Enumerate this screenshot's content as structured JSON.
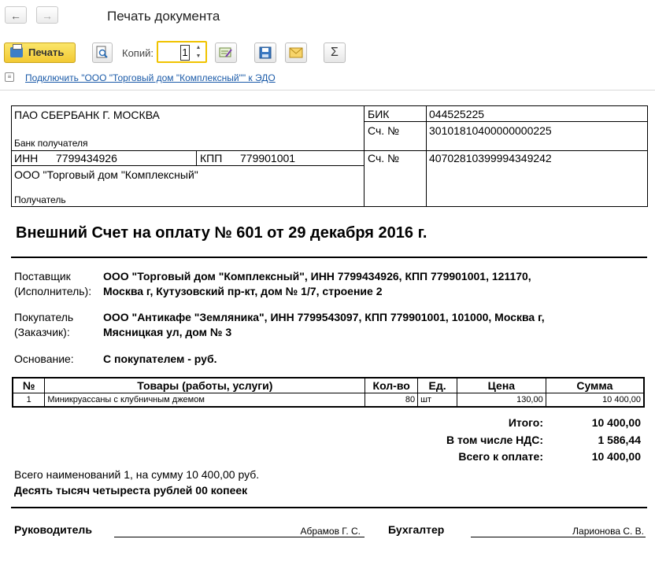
{
  "window": {
    "title": "Печать документа",
    "back_glyph": "←",
    "forward_glyph": "→"
  },
  "toolbar": {
    "print_label": "Печать",
    "copies_label": "Копий:",
    "copies_value": "1",
    "icons": [
      "preview-icon",
      "edit-icon",
      "save-icon",
      "email-icon",
      "sum-icon"
    ],
    "sum_glyph": "Σ"
  },
  "edo_link": "Подключить \"ООО \"Торговый дом \"Комплексный\"\" к ЭДО",
  "bank": {
    "name": "ПАО СБЕРБАНК Г. МОСКВА",
    "caption": "Банк получателя",
    "bik_label": "БИК",
    "bik": "044525225",
    "corr_label": "Сч. №",
    "corr_account": "30101810400000000225",
    "inn_label": "ИНН",
    "inn": "7799434926",
    "kpp_label": "КПП",
    "kpp": "779901001",
    "acc_label": "Сч. №",
    "account": "40702810399994349242",
    "recipient": "ООО \"Торговый дом \"Комплексный\"",
    "recipient_caption": "Получатель"
  },
  "invoice": {
    "title": "Внешний Счет на оплату № 601 от 29 декабря 2016 г.",
    "supplier_label_1": "Поставщик",
    "supplier_label_2": "(Исполнитель):",
    "supplier_line_1": "ООО \"Торговый дом \"Комплексный\", ИНН 7799434926, КПП 779901001, 121170,",
    "supplier_line_2": "Москва г, Кутузовский пр-кт, дом № 1/7, строение 2",
    "buyer_label_1": "Покупатель",
    "buyer_label_2": "(Заказчик):",
    "buyer_line_1": "ООО \"Антикафе \"Земляника\", ИНН 7799543097, КПП 779901001, 101000, Москва г,",
    "buyer_line_2": "Мясницкая ул, дом № 3",
    "basis_label": "Основание:",
    "basis_value": "С покупателем - руб."
  },
  "items_table": {
    "headers": [
      "№",
      "Товары (работы, услуги)",
      "Кол-во",
      "Ед.",
      "Цена",
      "Сумма"
    ],
    "rows": [
      [
        "1",
        "Миникруассаны с клубничным джемом",
        "80",
        "шт",
        "130,00",
        "10 400,00"
      ]
    ]
  },
  "totals": {
    "total_label": "Итого:",
    "total_value": "10 400,00",
    "vat_label": "В том числе НДС:",
    "vat_value": "1 586,44",
    "due_label": "Всего к оплате:",
    "due_value": "10 400,00"
  },
  "summary": {
    "count_text": "Всего наименований 1, на сумму 10 400,00 руб.",
    "words_text": "Десять тысяч четыреста рублей 00 копеек"
  },
  "signatures": {
    "head_label": "Руководитель",
    "head_name": "Абрамов Г. С.",
    "accountant_label": "Бухгалтер",
    "accountant_name": "Ларионова С. В."
  }
}
